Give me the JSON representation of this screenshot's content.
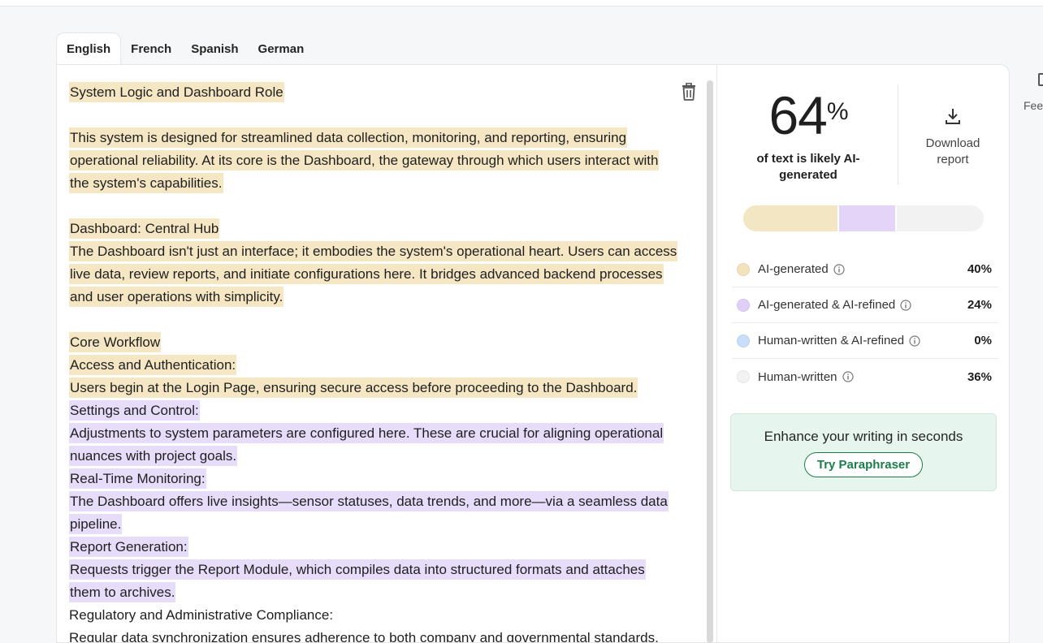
{
  "tabs": [
    {
      "label": "English",
      "active": true
    },
    {
      "label": "French",
      "active": false
    },
    {
      "label": "Spanish",
      "active": false
    },
    {
      "label": "German",
      "active": false
    }
  ],
  "editor": {
    "lines": [
      {
        "text": "System Logic and Dashboard Role",
        "hl": "ai"
      },
      {
        "text": "",
        "hl": "none"
      },
      {
        "text": "This system is designed for streamlined data collection, monitoring, and reporting, ensuring",
        "hl": "ai"
      },
      {
        "text": "operational reliability. At its core is the Dashboard, the gateway through which users interact with",
        "hl": "ai"
      },
      {
        "text": "the system's capabilities.",
        "hl": "ai"
      },
      {
        "text": "",
        "hl": "none"
      },
      {
        "text": "Dashboard: Central Hub",
        "hl": "ai"
      },
      {
        "text": "The Dashboard isn't just an interface; it embodies the system's operational heart. Users can access",
        "hl": "ai"
      },
      {
        "text": "live data, review reports, and initiate configurations here. It bridges advanced backend processes",
        "hl": "ai"
      },
      {
        "text": "and user operations with simplicity.",
        "hl": "ai"
      },
      {
        "text": "",
        "hl": "none"
      },
      {
        "text": "Core Workflow",
        "hl": "ai"
      },
      {
        "text": "Access and Authentication:",
        "hl": "ai"
      },
      {
        "text": "Users begin at the Login Page, ensuring secure access before proceeding to the Dashboard.",
        "hl": "ai"
      },
      {
        "text": "Settings and Control:",
        "hl": "ref"
      },
      {
        "text": "Adjustments to system parameters are configured here. These are crucial for aligning operational",
        "hl": "ref"
      },
      {
        "text": "nuances with project goals.",
        "hl": "ref"
      },
      {
        "text": "Real-Time Monitoring:",
        "hl": "ref"
      },
      {
        "text": "The Dashboard offers live insights—sensor statuses, data trends, and more—via a seamless data",
        "hl": "ref"
      },
      {
        "text": "pipeline.",
        "hl": "ref"
      },
      {
        "text": "Report Generation:",
        "hl": "ref"
      },
      {
        "text": "Requests trigger the Report Module, which compiles data into structured formats and attaches",
        "hl": "ref"
      },
      {
        "text": "them to archives.",
        "hl": "ref"
      },
      {
        "text": "Regulatory and Administrative Compliance:",
        "hl": "none"
      },
      {
        "text": "Regular data synchronization ensures adherence to both company and governmental standards.",
        "hl": "none"
      }
    ]
  },
  "score": {
    "value": "64",
    "unit": "%",
    "caption": "of text is likely AI-generated"
  },
  "download": {
    "label": "Download report"
  },
  "bar_segments": [
    {
      "percent": 40,
      "color": "#f3e6c2"
    },
    {
      "percent": 24,
      "color": "#e3d4f8"
    },
    {
      "percent": 0,
      "color": "#cfe2fb"
    },
    {
      "percent": 36,
      "color": "#f2f2f2"
    }
  ],
  "legend": [
    {
      "label": "AI-generated",
      "value": "40%",
      "color": "#f3e3bd"
    },
    {
      "label": "AI-generated & AI-refined",
      "value": "24%",
      "color": "#e0d0f7"
    },
    {
      "label": "Human-written & AI-refined",
      "value": "0%",
      "color": "#c9def8"
    },
    {
      "label": "Human-written",
      "value": "36%",
      "color": "#f2f2f2"
    }
  ],
  "promo": {
    "headline": "Enhance your writing in seconds",
    "button": "Try Paraphraser"
  },
  "side_panel": {
    "label": "Feedback"
  },
  "colors": {
    "accent_green": "#1b7e4a",
    "ai_highlight": "#f5e6c4",
    "refined_highlight": "#e7dcf9"
  }
}
